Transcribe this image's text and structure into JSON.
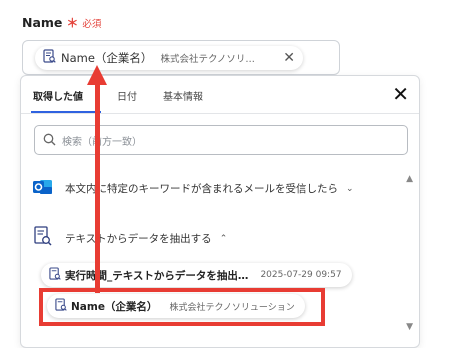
{
  "field": {
    "label": "Name",
    "required_star": "＊",
    "required_text": "必須",
    "token_name": "Name（企業名）",
    "token_value": "株式会社テクノソリ…",
    "token_close": "✕"
  },
  "panel": {
    "tabs": [
      "取得した値",
      "日付",
      "基本情報"
    ],
    "active_tab": "取得した値",
    "close_symbol": "✕",
    "search_placeholder": "検索（前方一致）",
    "groups": [
      {
        "label": "本文内に特定のキーワードが含まれるメールを受信したら",
        "chevron": "⌄",
        "icon": "outlook-icon"
      },
      {
        "label": "テキストからデータを抽出する",
        "chevron": "⌃",
        "icon": "text-extract-icon"
      }
    ],
    "items": [
      {
        "name": "実行時間_テキストからデータを抽出…",
        "value": "2025-07-29 09:57"
      },
      {
        "name": "Name（企業名）",
        "value": "株式会社テクノソリューション"
      }
    ]
  },
  "colors": {
    "accent": "#2f62e0",
    "highlight": "#e83c33",
    "required": "#e4453d",
    "outlook_blue": "#0a63c9"
  }
}
